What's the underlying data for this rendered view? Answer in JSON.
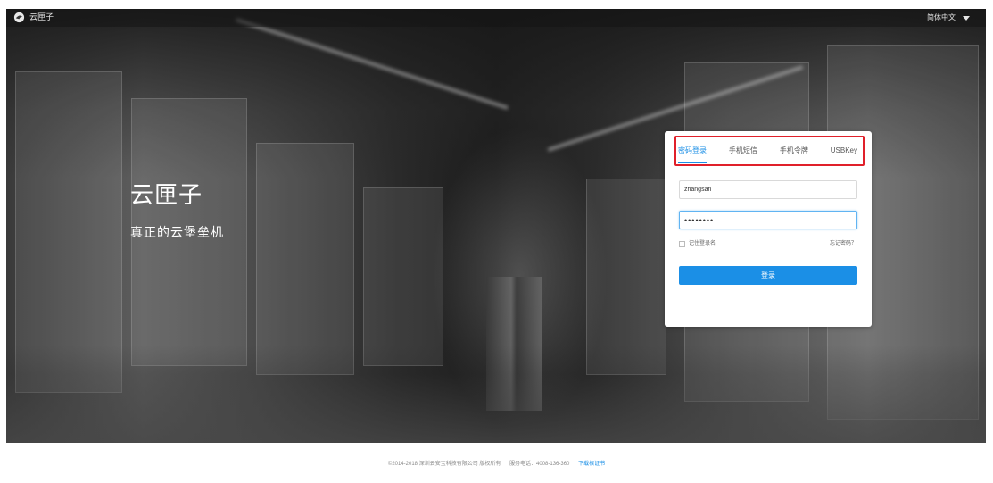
{
  "header": {
    "brand_name": "云匣子",
    "language": "简体中文"
  },
  "hero": {
    "title": "云匣子",
    "subtitle": "真正的云堡垒机"
  },
  "login": {
    "tabs": [
      {
        "label": "密码登录",
        "active": true
      },
      {
        "label": "手机短信",
        "active": false
      },
      {
        "label": "手机令牌",
        "active": false
      },
      {
        "label": "USBKey",
        "active": false
      }
    ],
    "username_value": "zhangsan",
    "password_value": "••••••••",
    "remember_label": "记住登录名",
    "forgot_label": "忘记密码？",
    "submit_label": "登录"
  },
  "footer": {
    "copyright": "©2014-2018 深圳云安宝科技有限公司 版权所有",
    "hotline": "服务电话：4008-136-360",
    "download_link": "下载根证书"
  },
  "colors": {
    "accent": "#1b8fe6",
    "highlight_box": "#e0202a"
  },
  "icons": {
    "brand": "brand-logo-icon",
    "language_toggle": "caret-down-icon"
  }
}
